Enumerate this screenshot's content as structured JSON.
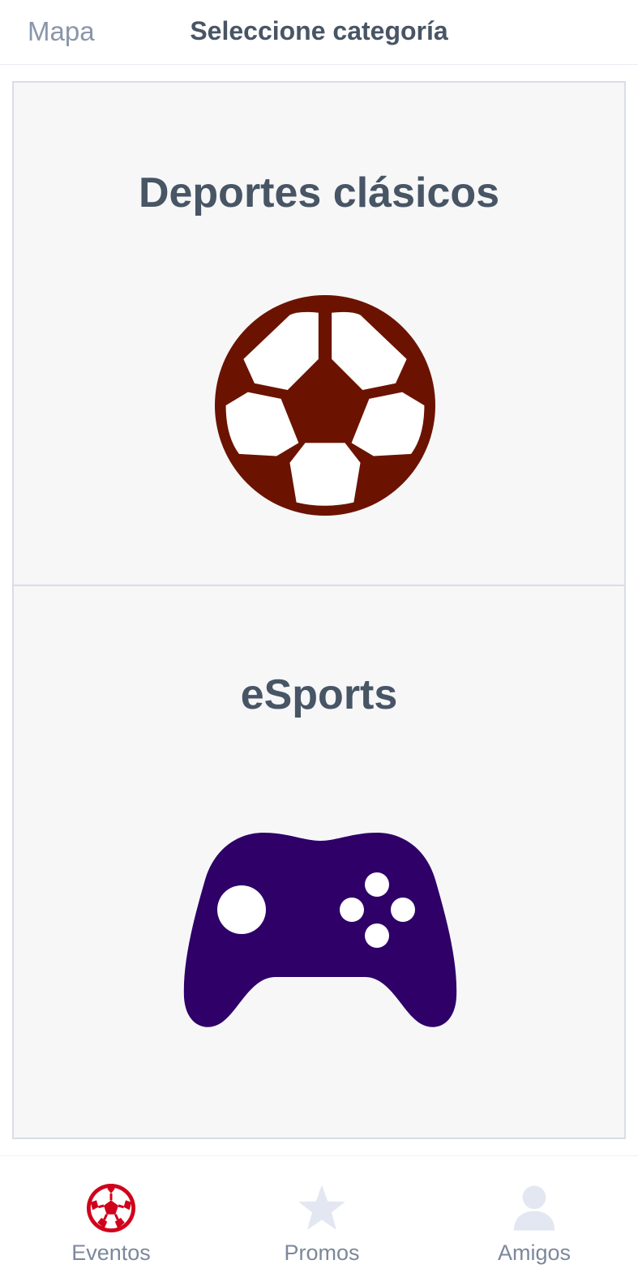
{
  "header": {
    "back_label": "Mapa",
    "title": "Seleccione categoría"
  },
  "categories": [
    {
      "title": "Deportes clásicos",
      "icon": "soccer-ball-icon",
      "icon_color": "#6b1300"
    },
    {
      "title": "eSports",
      "icon": "gamepad-icon",
      "icon_color": "#2e0068"
    }
  ],
  "tabbar": {
    "items": [
      {
        "label": "Eventos",
        "icon": "soccer-ball-icon",
        "active": true,
        "color": "#d0021b"
      },
      {
        "label": "Promos",
        "icon": "star-icon",
        "active": false,
        "color": "#e3e7f1"
      },
      {
        "label": "Amigos",
        "icon": "person-icon",
        "active": false,
        "color": "#e3e7f1"
      }
    ]
  },
  "colors": {
    "text": "#475565",
    "muted": "#8a96a8",
    "card_bg": "#f7f7f8",
    "card_border": "#d9dde6"
  }
}
